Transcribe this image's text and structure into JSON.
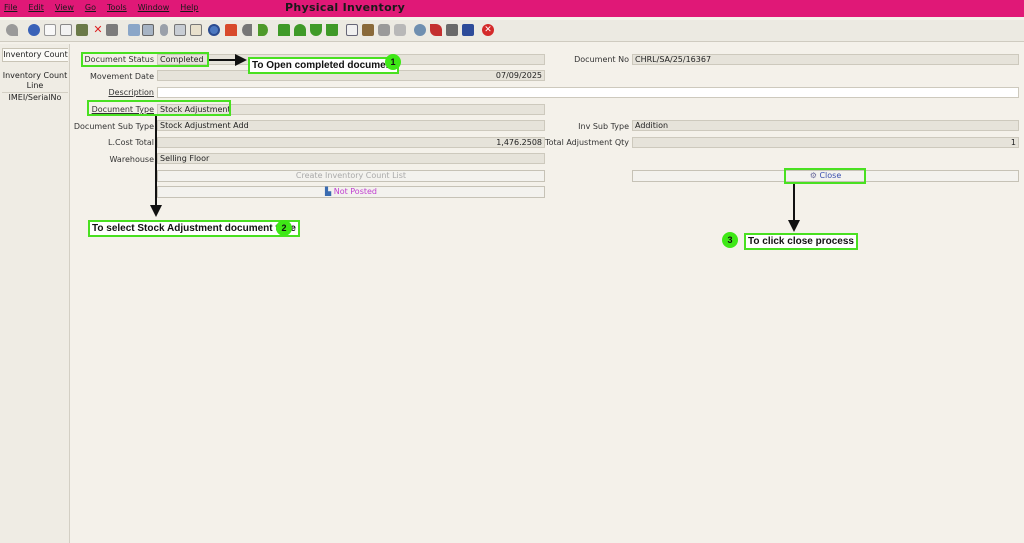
{
  "window": {
    "title": "Physical Inventory"
  },
  "menu": [
    "File",
    "Edit",
    "View",
    "Go",
    "Tools",
    "Window",
    "Help"
  ],
  "toolbar_icons": [
    "undo-icon",
    "help-icon",
    "new-icon",
    "copy-icon",
    "delete-icon",
    "delete-x-icon",
    "save-icon",
    "refresh-icon",
    "find-icon",
    "attach-icon",
    "chat-icon",
    "grid-toggle-icon",
    "history-icon",
    "home-icon",
    "back-icon",
    "forward-icon",
    "first-record-icon",
    "previous-record-icon",
    "next-record-icon",
    "last-record-icon",
    "report-icon",
    "archive-icon",
    "print-icon",
    "print-preview-icon",
    "zoom-icon",
    "workflow-icon",
    "product-info-icon",
    "process-icon",
    "exit-icon"
  ],
  "tabs": [
    "Inventory Count",
    "Inventory Count Line",
    "IMEI/SerialNo"
  ],
  "form": {
    "document_status": {
      "label": "Document Status",
      "value": "Completed"
    },
    "movement_date": {
      "label": "Movement Date",
      "value": "07/09/2025"
    },
    "description": {
      "label": "Description",
      "value": ""
    },
    "document_type": {
      "label": "Document Type",
      "value": "Stock Adjustment"
    },
    "document_sub_type": {
      "label": "Document Sub Type",
      "value": "Stock Adjustment Add"
    },
    "lcost_total": {
      "label": "L.Cost Total",
      "value": "1,476.2508"
    },
    "warehouse": {
      "label": "Warehouse",
      "value": "Selling Floor"
    },
    "document_no": {
      "label": "Document No",
      "value": "CHRL/SA/25/16367"
    },
    "inv_sub_type": {
      "label": "Inv Sub Type",
      "value": "Addition"
    },
    "total_adjustment_qty": {
      "label": "Total Adjustment Qty",
      "value": "1"
    },
    "create_count_list": "Create Inventory Count List",
    "not_posted": "Not Posted",
    "close": "Close"
  },
  "annotations": {
    "a1": {
      "number": "1",
      "text": "To Open completed document"
    },
    "a2": {
      "number": "2",
      "text": "To select Stock Adjustment document type"
    },
    "a3": {
      "number": "3",
      "text": "To click close process"
    }
  },
  "colors": {
    "titlebar": "#e01877",
    "annotation": "#49e021",
    "not_posted": "#c03fd0"
  }
}
